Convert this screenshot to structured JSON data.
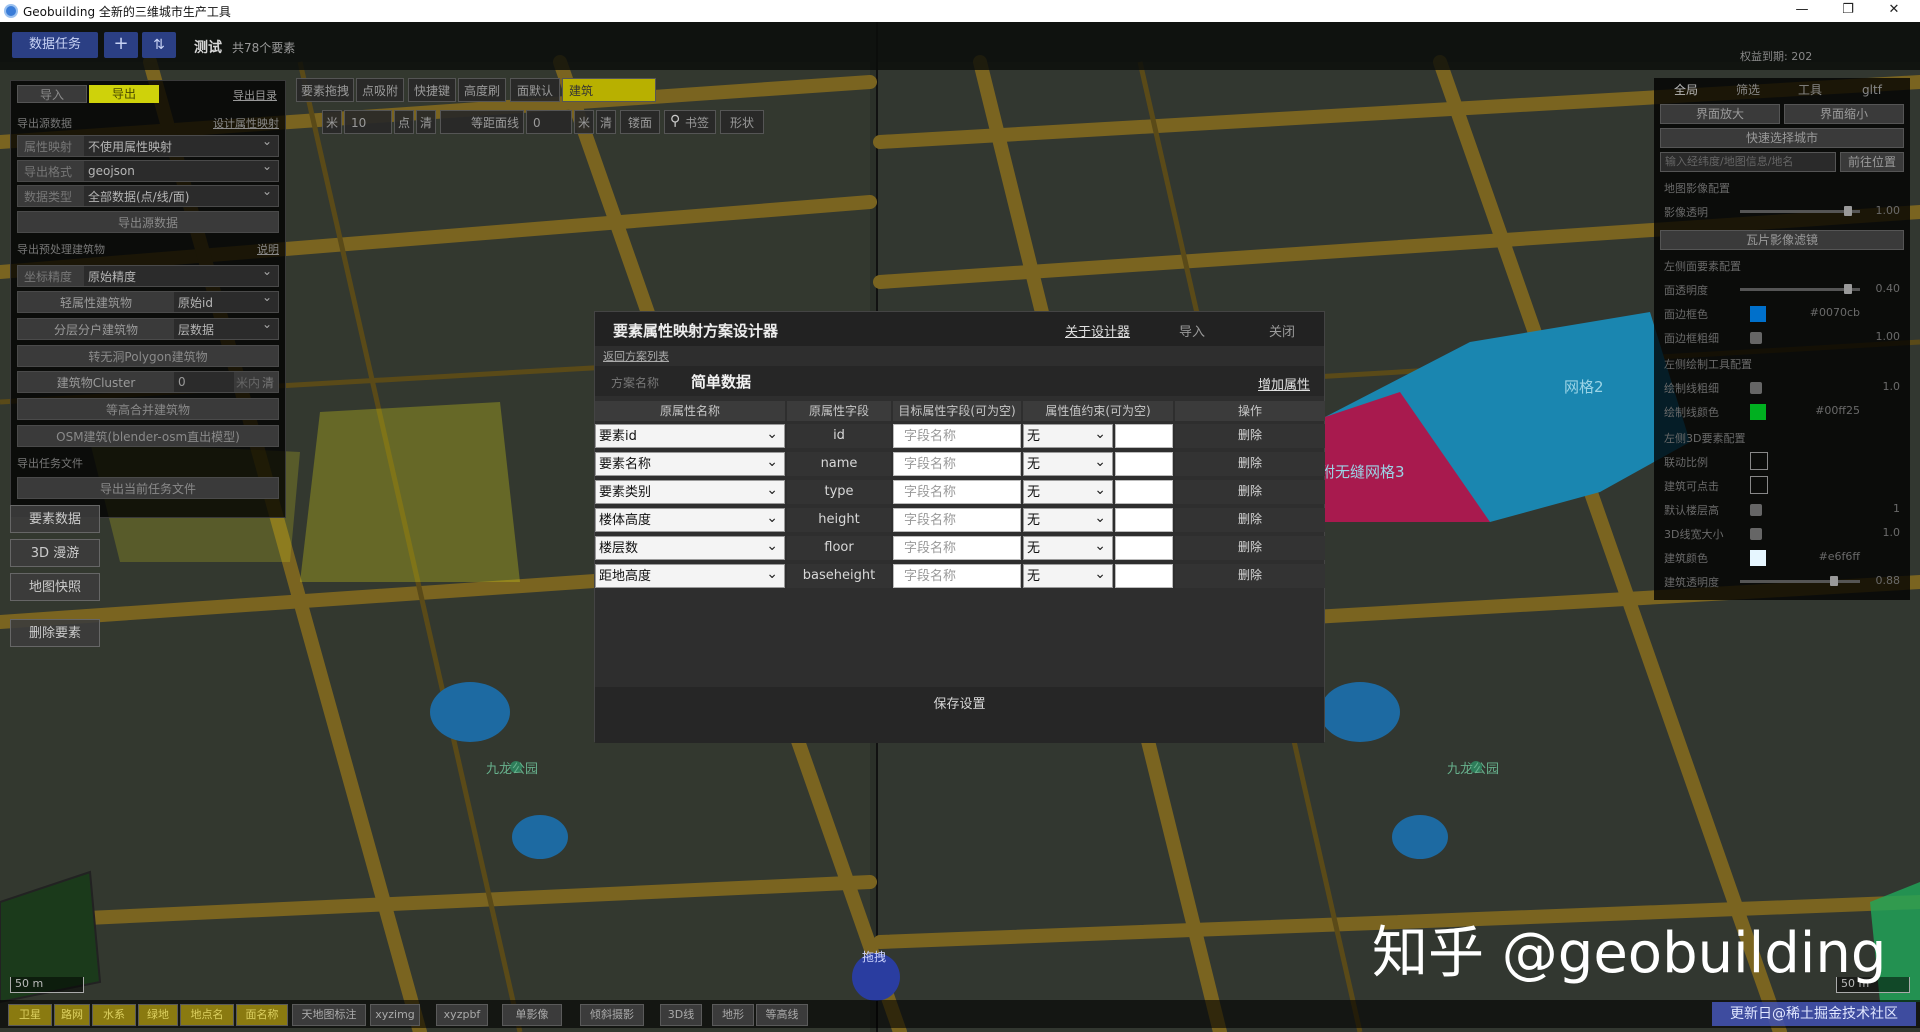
{
  "window": {
    "title": "Geobuilding 全新的三维城市生产工具",
    "min": "—",
    "max": "❐",
    "close": "✕"
  },
  "top": {
    "data_task": "数据任务",
    "plus": "+",
    "sort": "⇅",
    "project": "测试",
    "count": "共78个要素",
    "auth": "权益到期: 202"
  },
  "left": {
    "tab_import": "导入",
    "tab_export": "导出",
    "export_dir": "导出目录",
    "sec1": "导出源数据",
    "sec1_link": "设计属性映射",
    "r1_label": "属性映射",
    "r1_value": "不使用属性映射",
    "r2_label": "导出格式",
    "r2_value": "geojson",
    "r3_label": "数据类型",
    "r3_value": "全部数据(点/线/面)",
    "export_btn": "导出源数据",
    "sec2": "导出预处理建筑物",
    "sec2_link": "说明",
    "r4_label": "坐标精度",
    "r4_value": "原始精度",
    "r5_label": "轻属性建筑物",
    "r5_value": "原始id",
    "r6_label": "分层分户建筑物",
    "r6_value": "层数据",
    "r7": "转无洞Polygon建筑物",
    "r8_label": "建筑物Cluster",
    "r8_value": "0",
    "r8_unit": "米内",
    "r8_clear": "清",
    "r9": "等高合并建筑物",
    "r10": "OSM建筑(blender-osm直出模型)",
    "sec3": "导出任务文件",
    "r11": "导出当前任务文件",
    "b1": "要素数据",
    "b2": "3D 漫游",
    "b3": "地图快照",
    "b4": "删除要素"
  },
  "tools": {
    "t1": "要素拖拽",
    "t2": "点吸附",
    "t3": "快捷键",
    "t4": "高度刷",
    "t5": "面默认",
    "t6": "建筑",
    "n1": "米",
    "n2": "10",
    "n3": "点",
    "n4": "清",
    "n5": "等距面线",
    "n6": "0",
    "n7": "米",
    "n8": "清",
    "n9": "镂面",
    "n10": "书签",
    "n11": "形状"
  },
  "right": {
    "tab1": "全局",
    "tab2": "筛选",
    "tab3": "工具",
    "tab4": "gltf",
    "zoom_in": "界面放大",
    "zoom_out": "界面缩小",
    "quick_city": "快速选择城市",
    "search_placeholder": "输入经纬度/地图信息/地名",
    "goto": "前往位置",
    "img_cfg": "地图影像配置",
    "img_alpha": "影像透明",
    "img_alpha_val": "1.00",
    "tile_filter": "瓦片影像滤镜",
    "surf_cfg": "左侧面要素配置",
    "surf_alpha": "面透明度",
    "surf_alpha_val": "0.40",
    "surf_color": "面边框色",
    "surf_color_val": "#0070cb",
    "surf_color_hex": "#0070cb",
    "surf_width": "面边框粗细",
    "surf_width_val": "1.00",
    "draw_cfg": "左侧绘制工具配置",
    "draw_width": "绘制线粗细",
    "draw_width_val": "1.0",
    "draw_color": "绘制线颜色",
    "draw_color_val": "#00ff25",
    "draw_color_hex": "#00ff25",
    "cfg3d": "左侧3D要素配置",
    "c1": "联动比例",
    "c2": "建筑可点击",
    "c3": "默认楼层高",
    "c3_val": "1",
    "c4": "3D线宽大小",
    "c4_val": "1.0",
    "c5": "建筑颜色",
    "c5_val": "#e6f6ff",
    "c5_hex": "#e6f6ff",
    "c6": "建筑透明度",
    "c6_val": "0.88"
  },
  "map": {
    "mesh2": "网格2",
    "mesh3": "附无缝网格3",
    "park1": "九龙公园",
    "park2": "九龙公园",
    "drag": "拖拽",
    "scale": "50 m"
  },
  "bottom": {
    "b1": "卫星",
    "b2": "路网",
    "b3": "水系",
    "b4": "绿地",
    "b5": "地点名",
    "b6": "面名称",
    "b7": "天地图标注",
    "b8": "xyzimg",
    "b9": "xyzpbf",
    "b10": "单影像",
    "b11": "倾斜摄影",
    "b12": "3D线",
    "b13": "地形",
    "b14": "等高线"
  },
  "dialog": {
    "title": "要素属性映射方案设计器",
    "about": "关于设计器",
    "import": "导入",
    "close": "关闭",
    "back": "返回方案列表",
    "scheme_label": "方案名称",
    "scheme_name": "简单数据",
    "add": "增加属性",
    "headers": [
      "原属性名称",
      "原属性字段",
      "目标属性字段(可为空)",
      "属性值约束(可为空)",
      "操作"
    ],
    "rows": [
      {
        "name": "要素id",
        "field": "id",
        "target": "字段名称",
        "constraint": "无",
        "op": "删除"
      },
      {
        "name": "要素名称",
        "field": "name",
        "target": "字段名称",
        "constraint": "无",
        "op": "删除"
      },
      {
        "name": "要素类别",
        "field": "type",
        "target": "字段名称",
        "constraint": "无",
        "op": "删除"
      },
      {
        "name": "楼体高度",
        "field": "height",
        "target": "字段名称",
        "constraint": "无",
        "op": "删除"
      },
      {
        "name": "楼层数",
        "field": "floor",
        "target": "字段名称",
        "constraint": "无",
        "op": "删除"
      },
      {
        "name": "距地高度",
        "field": "baseheight",
        "target": "字段名称",
        "constraint": "无",
        "op": "删除"
      }
    ],
    "save": "保存设置"
  },
  "watermark": {
    "text": "知乎 @geobuilding",
    "badge": "更新日@稀土掘金技术社区"
  }
}
